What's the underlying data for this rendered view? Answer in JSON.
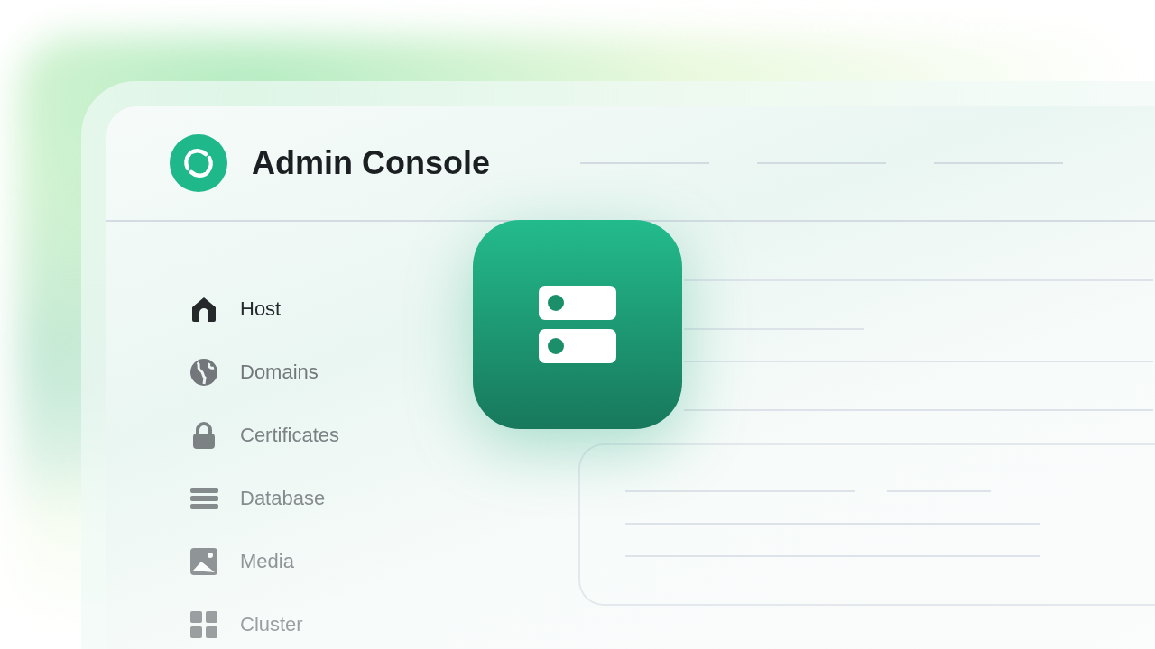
{
  "header": {
    "title": "Admin Console"
  },
  "sidebar": {
    "items": [
      {
        "label": "Host",
        "kind": "home",
        "selected": true
      },
      {
        "label": "Domains",
        "kind": "globe",
        "selected": false
      },
      {
        "label": "Certificates",
        "kind": "lock",
        "selected": false
      },
      {
        "label": "Database",
        "kind": "stack",
        "selected": false
      },
      {
        "label": "Media",
        "kind": "image",
        "selected": false
      },
      {
        "label": "Cluster",
        "kind": "grid",
        "selected": false
      }
    ]
  }
}
